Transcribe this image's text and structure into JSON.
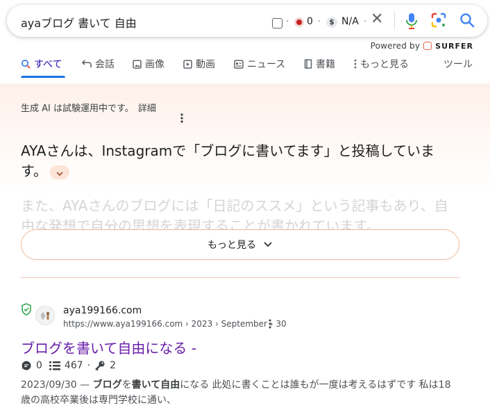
{
  "search": {
    "query": "ayaブログ 書いて 自由",
    "counter_zero": "0",
    "value_na": "N/A"
  },
  "powered": {
    "label": "Powered by",
    "brand": "SURFER"
  },
  "tabs": [
    {
      "label": "すべて",
      "icon": "search-icon"
    },
    {
      "label": "会話",
      "icon": "reply-icon"
    },
    {
      "label": "画像",
      "icon": "image-icon"
    },
    {
      "label": "動画",
      "icon": "play-icon"
    },
    {
      "label": "ニュース",
      "icon": "news-icon"
    },
    {
      "label": "書籍",
      "icon": "book-icon"
    },
    {
      "label": "もっと見る",
      "icon": "more-vert-icon"
    },
    {
      "label": "ツール",
      "icon": ""
    }
  ],
  "ai_overview": {
    "disclaimer": "生成 AI は試験運用中です。",
    "details_link": "詳細",
    "main_text": "AYAさんは、Instagramで「ブログに書いてます」と投稿していま す。",
    "faded_text": "また、AYAさんのブログには「日記のススメ」という記事もあり、自由な発想で自分の思想を表現することが書かれています。",
    "more_button": "もっと見る"
  },
  "result": {
    "site_name": "aya199166.com",
    "url": "https://www.aya199166.com › 2023 › September › 30",
    "title": "ブログを書いて自由になる -",
    "comments": "0",
    "words": "467",
    "keys": "2",
    "snippet_date": "2023/09/30 —",
    "snippet_b1": "ブログ",
    "snippet_t1": "を",
    "snippet_b2": "書いて自由",
    "snippet_t2": "になる 此処に書くことは誰もが一度は考えるはずです 私は18歳の高校卒業後は専門学校に通い、"
  },
  "colors": {
    "accent": "#1a73e8",
    "visited_title": "#681da8",
    "surfer_brand": "#e8684a"
  }
}
